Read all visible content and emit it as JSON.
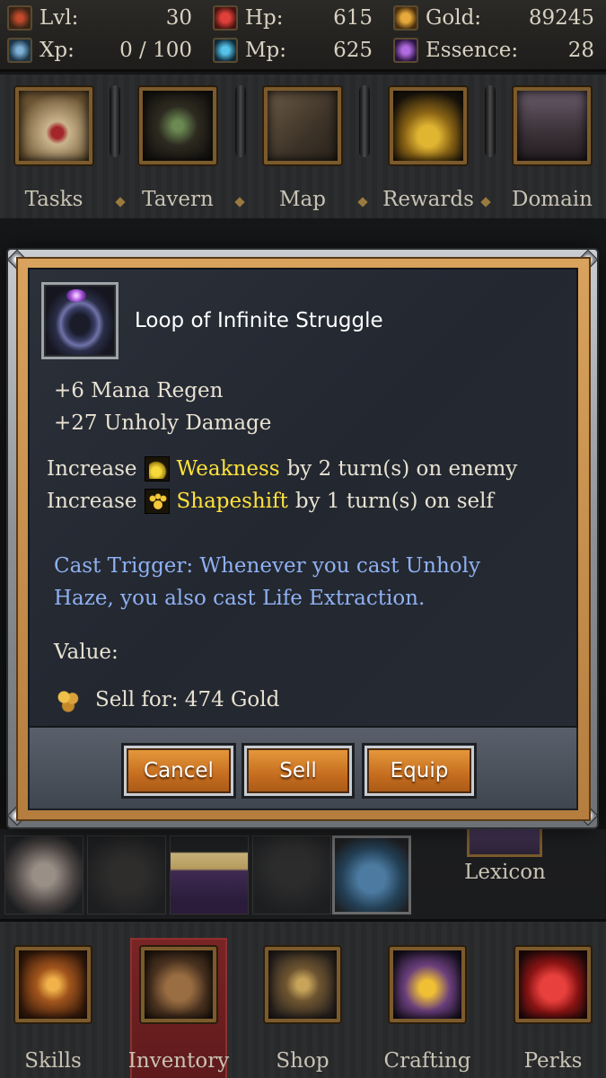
{
  "stats": {
    "level": {
      "label": "Lvl:",
      "value": "30"
    },
    "xp": {
      "label": "Xp:",
      "value": "0 / 100"
    },
    "hp": {
      "label": "Hp:",
      "value": "615"
    },
    "mp": {
      "label": "Mp:",
      "value": "625"
    },
    "gold": {
      "label": "Gold:",
      "value": "89245"
    },
    "essence": {
      "label": "Essence:",
      "value": "28"
    }
  },
  "top_nav": [
    {
      "label": "Tasks",
      "icon": "scroll-seal-icon"
    },
    {
      "label": "Tavern",
      "icon": "tavern-wagon-icon"
    },
    {
      "label": "Map",
      "icon": "map-icon"
    },
    {
      "label": "Rewards",
      "icon": "gold-pile-icon"
    },
    {
      "label": "Domain",
      "icon": "castle-icon"
    }
  ],
  "modal": {
    "item_name": "Loop of Infinite Struggle",
    "stats": [
      "+6 Mana Regen",
      "+27 Unholy Damage"
    ],
    "effects": [
      {
        "prefix": "Increase",
        "name": "Weakness",
        "suffix": "by 2 turn(s) on enemy",
        "icon": "weakness-icon"
      },
      {
        "prefix": "Increase",
        "name": "Shapeshift",
        "suffix": "by 1 turn(s) on self",
        "icon": "paw-icon"
      }
    ],
    "cast_trigger": "Cast Trigger: Whenever you cast Unholy Haze, you also cast Life Extraction.",
    "value_label": "Value:",
    "sell_text": "Sell for: 474 Gold",
    "buttons": {
      "cancel": "Cancel",
      "sell": "Sell",
      "equip": "Equip"
    }
  },
  "equipment": {
    "lexicon_label": "Lexicon"
  },
  "bottom_nav": [
    {
      "label": "Skills",
      "icon": "crossed-swords-icon"
    },
    {
      "label": "Inventory",
      "icon": "backpack-icon",
      "active": true
    },
    {
      "label": "Shop",
      "icon": "scales-icon"
    },
    {
      "label": "Crafting",
      "icon": "hourglass-icon"
    },
    {
      "label": "Perks",
      "icon": "heart-icon"
    }
  ],
  "colors": {
    "accent_orange": "#c56d1f",
    "effect_yellow": "#ffe23a",
    "trigger_blue": "#8fb1f2",
    "active_tab_red": "#7a2425"
  }
}
